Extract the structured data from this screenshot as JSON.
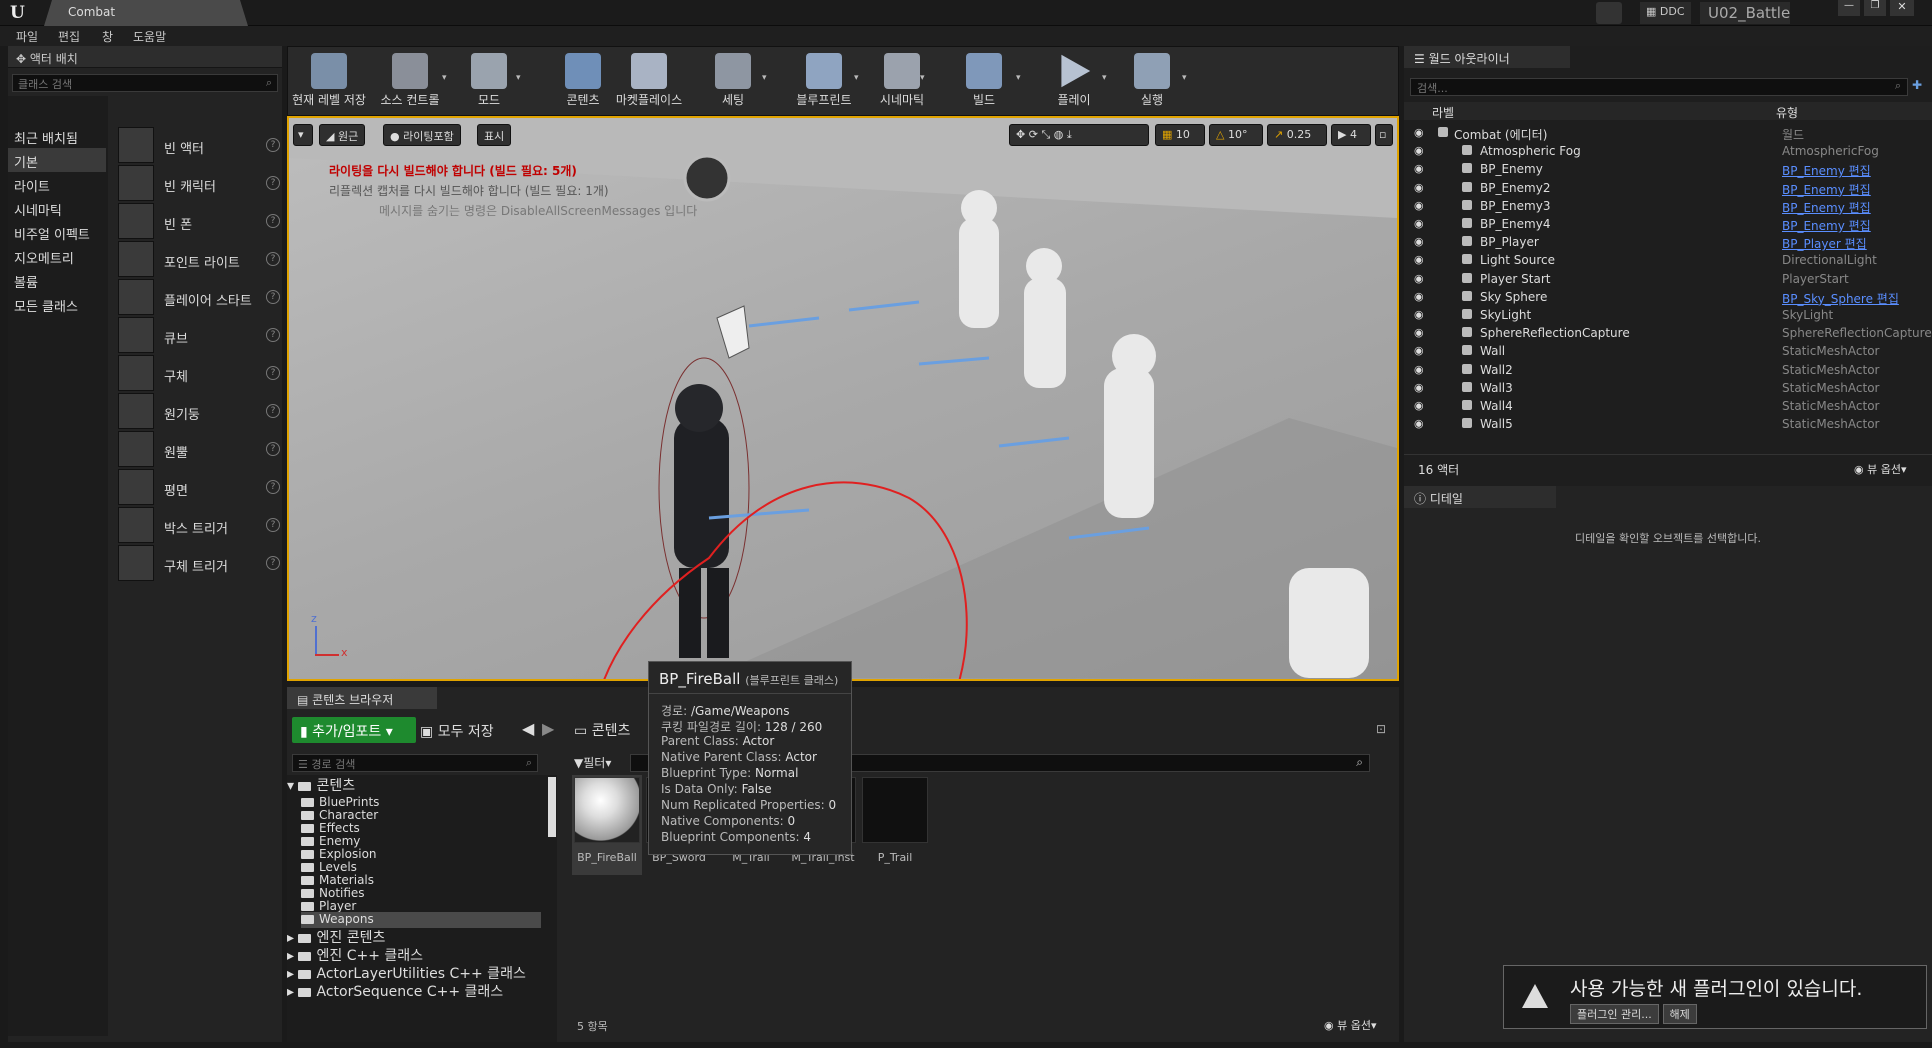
{
  "window": {
    "tab_title": "Combat",
    "ddc_label": "DDC",
    "project_name": "U02_Battle"
  },
  "menu": [
    "파일",
    "편집",
    "창",
    "도움말"
  ],
  "place_panel": {
    "title": "액터 배치",
    "search_placeholder": "클래스 검색",
    "categories": [
      "최근 배치됨",
      "기본",
      "라이트",
      "시네마틱",
      "비주얼 이펙트",
      "지오메트리",
      "볼륨",
      "모든 클래스"
    ],
    "selected_category": "기본",
    "items": [
      "빈 액터",
      "빈 캐릭터",
      "빈 폰",
      "포인트 라이트",
      "플레이어 스타트",
      "큐브",
      "구체",
      "원기둥",
      "원뿔",
      "평면",
      "박스 트리거",
      "구체 트리거"
    ]
  },
  "toolbar": {
    "buttons": [
      "현재 레벨 저장",
      "소스 컨트롤",
      "모드",
      "콘텐츠",
      "마켓플레이스",
      "세팅",
      "블루프린트",
      "시네마틱",
      "빌드",
      "플레이",
      "실행"
    ]
  },
  "viewport": {
    "view_mode": "원근",
    "lighting": "라이팅포함",
    "show": "표시",
    "grid_snap": "10",
    "rot_snap": "10°",
    "scale_snap": "0.25",
    "camera_speed": "4",
    "warnings": [
      "라이팅을 다시 빌드해야 합니다 (빌드 필요: 5개)",
      "리플렉션 캡처를 다시 빌드해야 합니다 (빌드 필요: 1개)",
      "메시지를 숨기는 명령은 DisableAllScreenMessages 입니다"
    ],
    "axis_x": "x",
    "axis_z": "z"
  },
  "content_browser": {
    "tab": "콘텐츠 브라우저",
    "add_import": "추가/임포트",
    "save_all": "모두 저장",
    "path": "콘텐츠",
    "path_search_placeholder": "경로 검색",
    "filter": "필터",
    "tree_root": "콘텐츠",
    "folders": [
      "BluePrints",
      "Character",
      "Effects",
      "Enemy",
      "Explosion",
      "Levels",
      "Materials",
      "Notifies",
      "Player",
      "Weapons"
    ],
    "extra_roots": [
      "엔진 콘텐츠",
      "엔진 C++ 클래스",
      "ActorLayerUtilities C++ 클래스",
      "ActorSequence C++ 클래스"
    ],
    "assets": [
      "BP_FireBall",
      "BP_Sword",
      "M_Trail",
      "M_Trail_Inst",
      "P_Trail"
    ],
    "item_count": "5 항목",
    "view_options": "뷰 옵션"
  },
  "tooltip": {
    "title": "BP_FireBall",
    "subtitle": "(블루프린트 클래스)",
    "lines": [
      {
        "k": "경로:",
        "v": "/Game/Weapons"
      },
      {
        "k": "쿠킹 파일경로 길이:",
        "v": "128 / 260"
      },
      {
        "k": "Parent Class:",
        "v": "Actor"
      },
      {
        "k": "Native Parent Class:",
        "v": "Actor"
      },
      {
        "k": "Blueprint Type:",
        "v": "Normal"
      },
      {
        "k": "Is Data Only:",
        "v": "False"
      },
      {
        "k": "Num Replicated Properties:",
        "v": "0"
      },
      {
        "k": "Native Components:",
        "v": "0"
      },
      {
        "k": "Blueprint Components:",
        "v": "4"
      }
    ]
  },
  "outliner": {
    "title": "월드 아웃라이너",
    "search_placeholder": "검색...",
    "col_label": "라벨",
    "col_type": "유형",
    "rows": [
      {
        "name": "Combat (에디터)",
        "type": "월드",
        "link": false
      },
      {
        "name": "Atmospheric Fog",
        "type": "AtmosphericFog",
        "link": false
      },
      {
        "name": "BP_Enemy",
        "type": "BP_Enemy 편집",
        "link": true
      },
      {
        "name": "BP_Enemy2",
        "type": "BP_Enemy 편집",
        "link": true
      },
      {
        "name": "BP_Enemy3",
        "type": "BP_Enemy 편집",
        "link": true
      },
      {
        "name": "BP_Enemy4",
        "type": "BP_Enemy 편집",
        "link": true
      },
      {
        "name": "BP_Player",
        "type": "BP_Player 편집",
        "link": true
      },
      {
        "name": "Light Source",
        "type": "DirectionalLight",
        "link": false
      },
      {
        "name": "Player Start",
        "type": "PlayerStart",
        "link": false
      },
      {
        "name": "Sky Sphere",
        "type": "BP_Sky_Sphere 편집",
        "link": true
      },
      {
        "name": "SkyLight",
        "type": "SkyLight",
        "link": false
      },
      {
        "name": "SphereReflectionCapture",
        "type": "SphereReflectionCapture",
        "link": false
      },
      {
        "name": "Wall",
        "type": "StaticMeshActor",
        "link": false
      },
      {
        "name": "Wall2",
        "type": "StaticMeshActor",
        "link": false
      },
      {
        "name": "Wall3",
        "type": "StaticMeshActor",
        "link": false
      },
      {
        "name": "Wall4",
        "type": "StaticMeshActor",
        "link": false
      },
      {
        "name": "Wall5",
        "type": "StaticMeshActor",
        "link": false
      }
    ],
    "actor_count": "16 액터",
    "view_options": "뷰 옵션"
  },
  "details": {
    "title": "디테일",
    "empty_msg": "디테일을 확인할 오브젝트를 선택합니다."
  },
  "notification": {
    "text": "사용 가능한 새 플러그인이 있습니다.",
    "manage_btn": "플러그인 관리...",
    "dismiss_btn": "해제"
  },
  "colors": {
    "accent_orange": "#e0a300",
    "link_blue": "#5a8eff",
    "warning_red": "#c00000",
    "annotation_red": "#e02020"
  }
}
